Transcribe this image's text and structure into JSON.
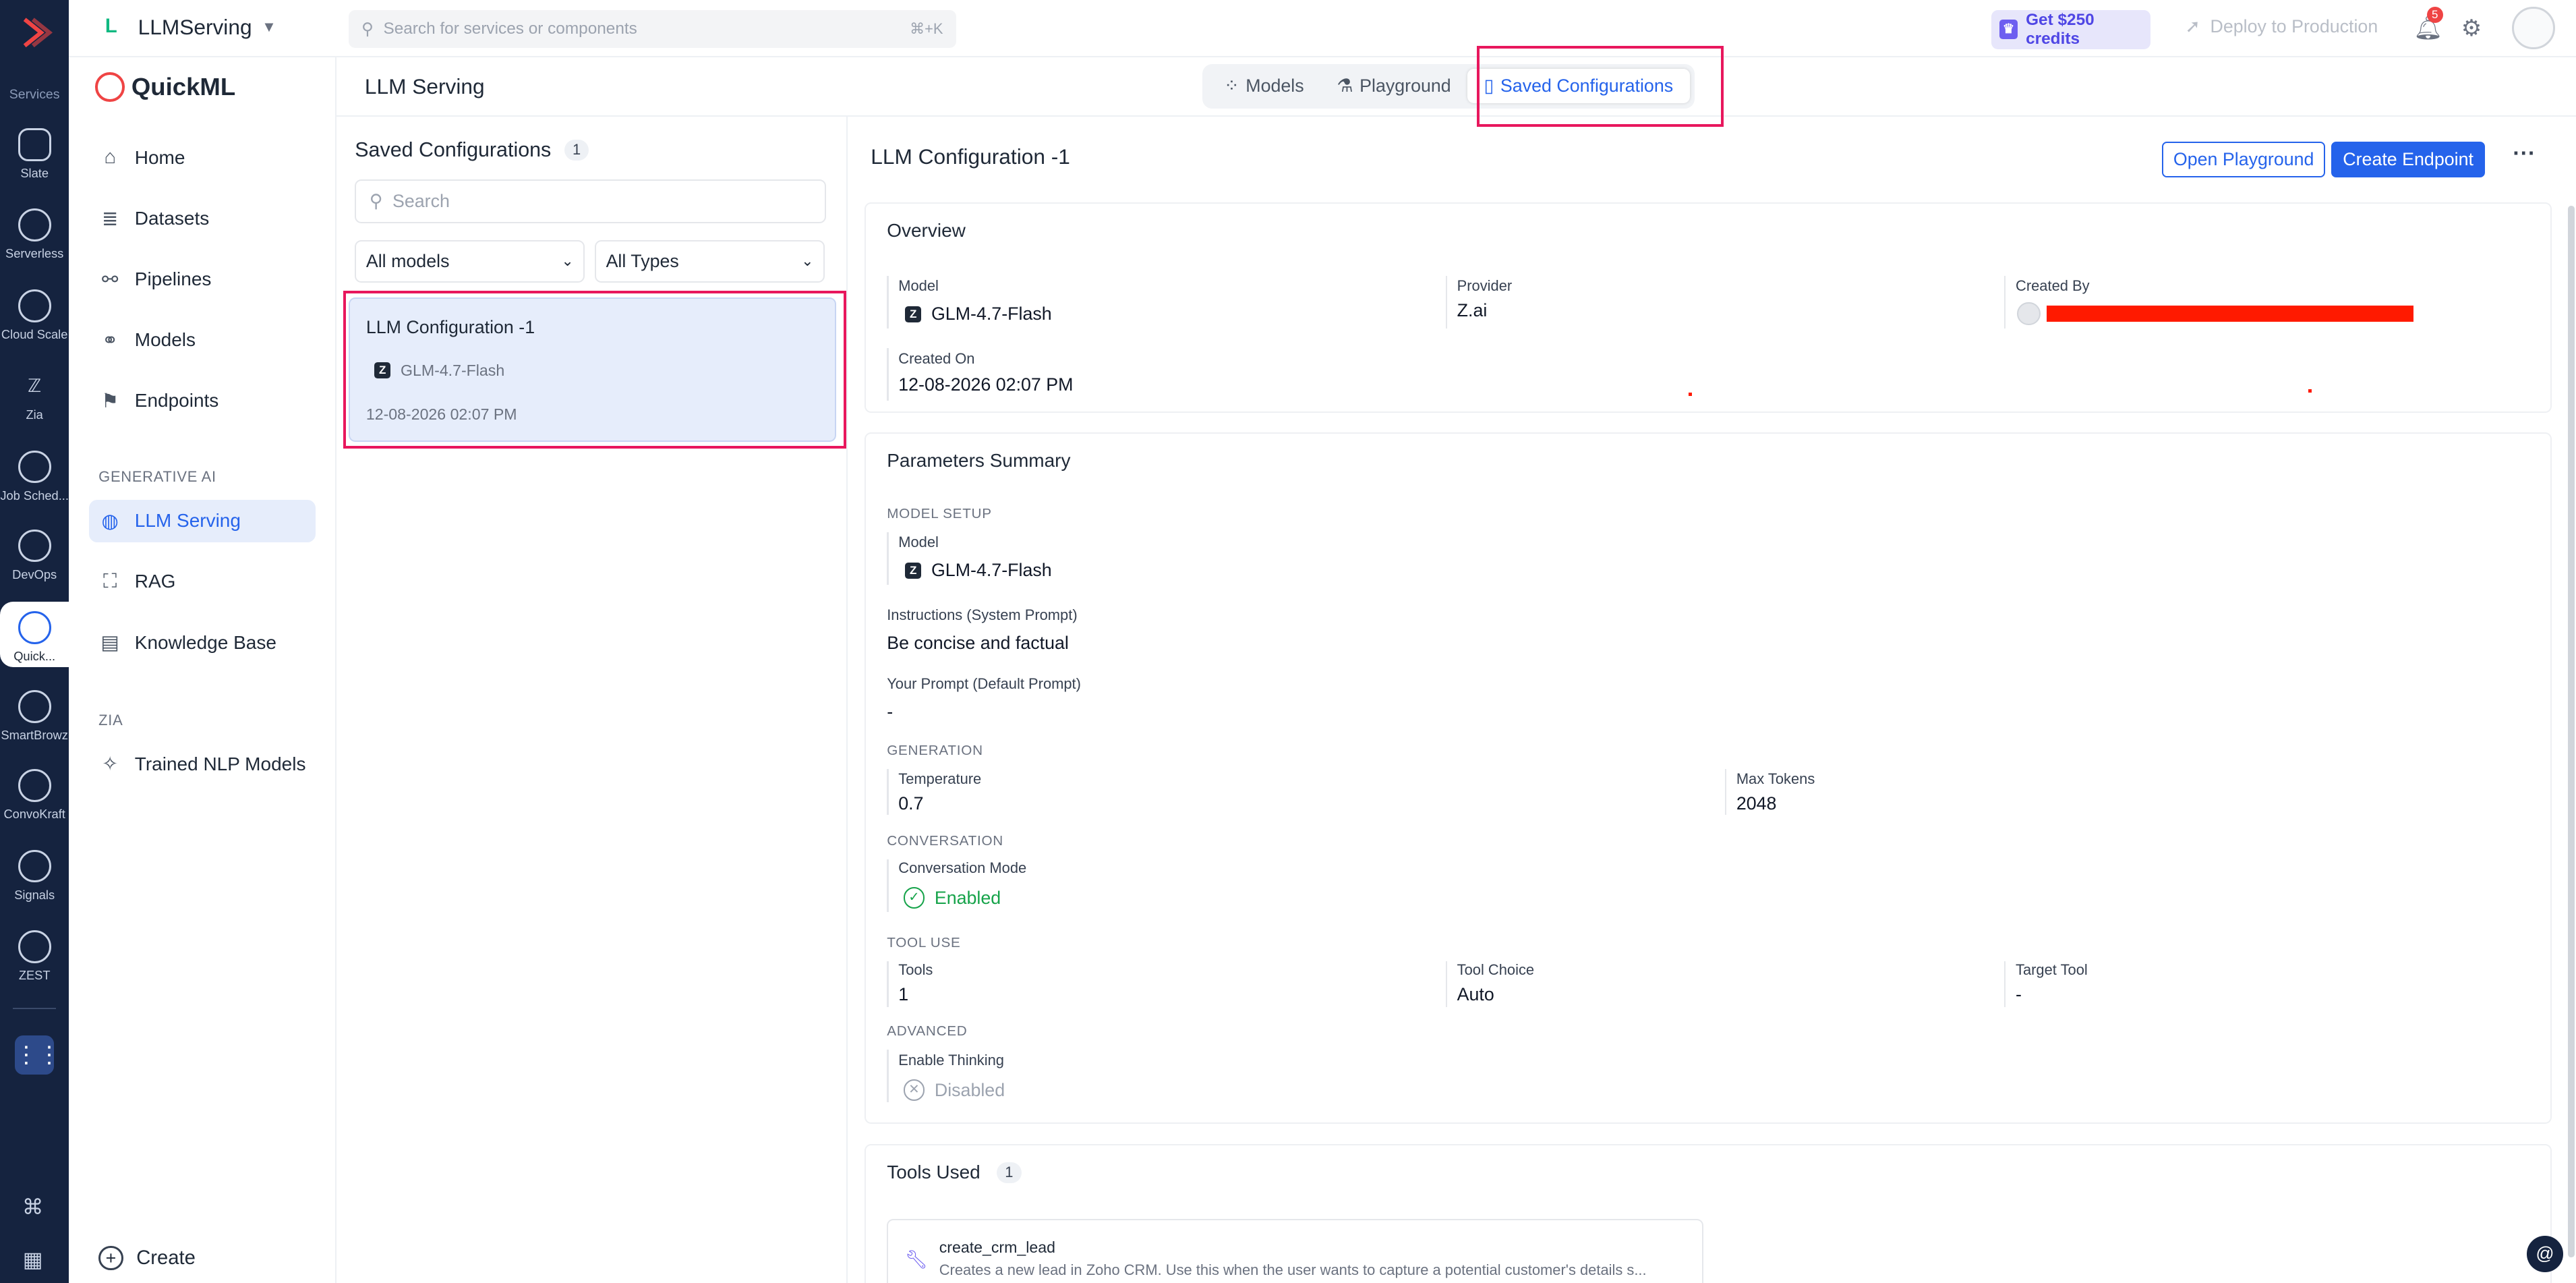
{
  "rail": {
    "services_label": "Services",
    "items": [
      {
        "label": "Slate",
        "icon": "slate-icon"
      },
      {
        "label": "Serverless",
        "icon": "serverless-icon"
      },
      {
        "label": "Cloud Scale",
        "icon": "cloud-scale-icon"
      },
      {
        "label": "Zia",
        "icon": "zia-icon"
      },
      {
        "label": "Job Sched...",
        "icon": "job-scheduler-icon"
      },
      {
        "label": "DevOps",
        "icon": "devops-icon"
      },
      {
        "label": "Quick...",
        "icon": "quickml-icon"
      },
      {
        "label": "SmartBrowz",
        "icon": "smartbrowz-icon"
      },
      {
        "label": "ConvoKraft",
        "icon": "convokraft-icon"
      },
      {
        "label": "Signals",
        "icon": "signals-icon"
      },
      {
        "label": "ZEST",
        "icon": "zest-icon"
      }
    ]
  },
  "topbar": {
    "project_initial": "L",
    "project_name": "LLMServing",
    "search_placeholder": "Search for services or components",
    "search_shortcut": "⌘+K",
    "credits_label": "Get $250 credits",
    "deploy_label": "Deploy to Production",
    "notification_count": "5"
  },
  "nav": {
    "brand": "QuickML",
    "items": [
      {
        "label": "Home",
        "icon": "home-icon"
      },
      {
        "label": "Datasets",
        "icon": "datasets-icon"
      },
      {
        "label": "Pipelines",
        "icon": "pipelines-icon"
      },
      {
        "label": "Models",
        "icon": "models-icon"
      },
      {
        "label": "Endpoints",
        "icon": "endpoints-icon"
      }
    ],
    "section_genai": "GENERATIVE AI",
    "genai_items": [
      {
        "label": "LLM Serving",
        "icon": "llm-serving-icon"
      },
      {
        "label": "RAG",
        "icon": "rag-icon"
      },
      {
        "label": "Knowledge Base",
        "icon": "knowledge-base-icon"
      }
    ],
    "section_zia": "ZIA",
    "zia_items": [
      {
        "label": "Trained NLP Models",
        "icon": "sparkle-icon"
      }
    ],
    "create_label": "Create"
  },
  "main": {
    "title": "LLM Serving",
    "tabs": [
      {
        "label": "Models"
      },
      {
        "label": "Playground"
      },
      {
        "label": "Saved Configurations"
      }
    ]
  },
  "list": {
    "heading": "Saved Configurations",
    "count": "1",
    "search_placeholder": "Search",
    "filter_models": "All models",
    "filter_types": "All Types",
    "cards": [
      {
        "title": "LLM Configuration -1",
        "model": "GLM-4.7-Flash",
        "date": "12-08-2026 02:07 PM"
      }
    ]
  },
  "detail": {
    "title": "LLM Configuration -1",
    "open_playground": "Open Playground",
    "create_endpoint": "Create Endpoint",
    "overview": {
      "heading": "Overview",
      "model_label": "Model",
      "model_value": "GLM-4.7-Flash",
      "provider_label": "Provider",
      "provider_value": "Z.ai",
      "created_by_label": "Created By",
      "created_on_label": "Created On",
      "created_on_value": "12-08-2026 02:07 PM"
    },
    "params": {
      "heading": "Parameters Summary",
      "model_setup": "MODEL SETUP",
      "model_label": "Model",
      "model_value": "GLM-4.7-Flash",
      "instructions_label": "Instructions (System Prompt)",
      "instructions_value": "Be concise and factual",
      "prompt_label": "Your Prompt (Default Prompt)",
      "prompt_value": "-",
      "generation": "GENERATION",
      "temperature_label": "Temperature",
      "temperature_value": "0.7",
      "max_tokens_label": "Max Tokens",
      "max_tokens_value": "2048",
      "conversation": "CONVERSATION",
      "conv_mode_label": "Conversation Mode",
      "conv_mode_value": "Enabled",
      "tool_use": "TOOL USE",
      "tools_label": "Tools",
      "tools_value": "1",
      "tool_choice_label": "Tool Choice",
      "tool_choice_value": "Auto",
      "target_tool_label": "Target Tool",
      "target_tool_value": "-",
      "advanced": "ADVANCED",
      "thinking_label": "Enable Thinking",
      "thinking_value": "Disabled"
    },
    "tools": {
      "heading": "Tools Used",
      "count": "1",
      "items": [
        {
          "name": "create_crm_lead",
          "description": "Creates a new lead in Zoho CRM. Use this when the user wants to capture a potential customer's details s..."
        }
      ]
    }
  },
  "colors": {
    "rail_bg": "#15233f",
    "accent": "#2563eb",
    "highlight_box": "#e8175d",
    "redaction": "#ff1a00",
    "enabled": "#16a34a"
  }
}
